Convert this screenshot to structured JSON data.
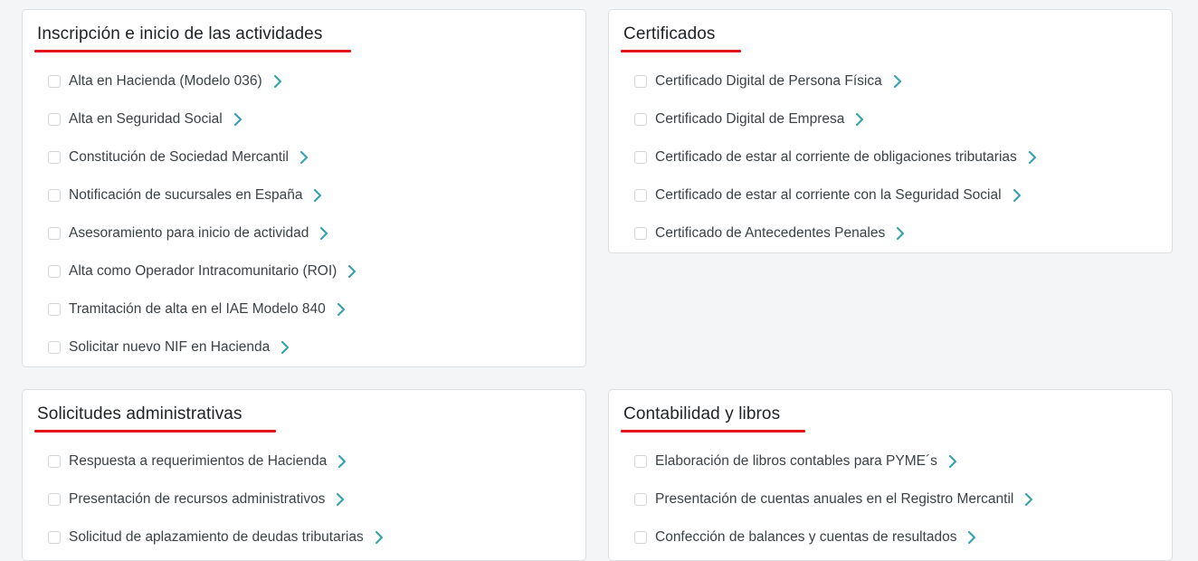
{
  "colors": {
    "accent_chevron": "#3aa3b0",
    "underline_red": "#e3141b",
    "card_bg": "#ffffff",
    "page_bg": "#f4f5f7"
  },
  "cards": [
    {
      "title": "Inscripción e inicio de las actividades",
      "items": [
        "Alta en Hacienda (Modelo 036)",
        "Alta en Seguridad Social",
        "Constitución de Sociedad Mercantil",
        "Notificación de sucursales en España",
        "Asesoramiento para inicio de actividad",
        "Alta como Operador Intracomunitario (ROI)",
        "Tramitación de alta en el IAE Modelo 840",
        "Solicitar nuevo NIF en Hacienda"
      ]
    },
    {
      "title": "Certificados",
      "items": [
        "Certificado Digital de Persona Física",
        "Certificado Digital de Empresa",
        "Certificado de estar al corriente de obligaciones tributarias",
        "Certificado de estar al corriente con la Seguridad Social",
        "Certificado de Antecedentes Penales"
      ]
    },
    {
      "title": "Solicitudes administrativas",
      "items": [
        "Respuesta a requerimientos de Hacienda",
        "Presentación de recursos administrativos",
        "Solicitud de aplazamiento de deudas tributarias"
      ]
    },
    {
      "title": "Contabilidad y libros",
      "items": [
        "Elaboración de libros contables para PYME´s",
        "Presentación de cuentas anuales en el Registro Mercantil",
        "Confección de balances y cuentas de resultados"
      ]
    }
  ]
}
